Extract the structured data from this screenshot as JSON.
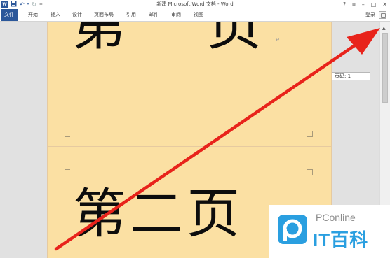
{
  "window": {
    "title": "新建 Microsoft Word 文档 - Word",
    "controls": {
      "help": "?",
      "minimize": "–",
      "restore": "□",
      "close": "✕"
    }
  },
  "quick_access": {
    "app_icon": "W",
    "save": "save-icon",
    "undo": "undo-icon",
    "redo": "redo-icon",
    "customize": "customize-icon"
  },
  "ribbon": {
    "file_tab": "文件",
    "tabs": [
      "开始",
      "插入",
      "设计",
      "页面布局",
      "引用",
      "邮件",
      "审阅",
      "视图"
    ],
    "login": "登录"
  },
  "document": {
    "page1_text": "第页",
    "page2_text": "第二页",
    "paragraph_mark": "↵"
  },
  "tooltip": {
    "text": "页码: 1"
  },
  "watermark": {
    "brand": "PConline",
    "name": "IT百科"
  },
  "colors": {
    "page": "#fbe0a3",
    "accent": "#2b579a",
    "arrow": "#e8231b",
    "watermark": "#2a9fe0"
  }
}
